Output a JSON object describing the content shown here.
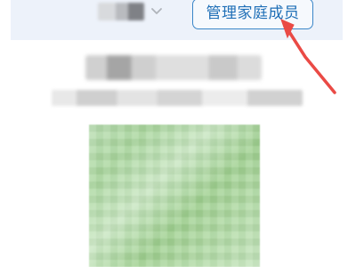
{
  "header": {
    "manage_button_label": "管理家庭成员"
  },
  "icons": {
    "dropdown": "chevron-down-icon"
  },
  "colors": {
    "accent": "#1f6fb7",
    "arrow": "#ea4a45",
    "header_bg": "#edf2fa",
    "qr_green": "#a8d69c"
  }
}
